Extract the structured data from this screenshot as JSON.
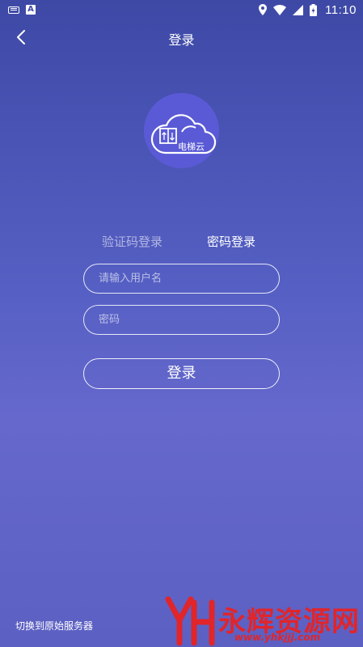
{
  "status_bar": {
    "time": "11:10",
    "left_icons": [
      "keyboard-icon",
      "a-notification-icon"
    ],
    "right_icons": [
      "location-icon",
      "wifi-icon",
      "signal-icon",
      "battery-icon"
    ]
  },
  "header": {
    "title": "登录",
    "back_icon": "chevron-left-icon"
  },
  "logo": {
    "text": "电梯云",
    "color": "#5a5ad6"
  },
  "tabs": [
    {
      "label": "验证码登录",
      "active": false
    },
    {
      "label": "密码登录",
      "active": true
    }
  ],
  "form": {
    "username_placeholder": "请输入用户名",
    "password_placeholder": "密码",
    "submit_label": "登录"
  },
  "footer": {
    "switch_server_label": "切换到原始服务器"
  },
  "watermark": {
    "text": "永辉资源网",
    "url": "www.yhkjjj.com",
    "color": "#e0252b"
  },
  "colors": {
    "bg_top": "#3e49a6",
    "bg_mid": "#6668cc",
    "accent": "#ffffff"
  }
}
